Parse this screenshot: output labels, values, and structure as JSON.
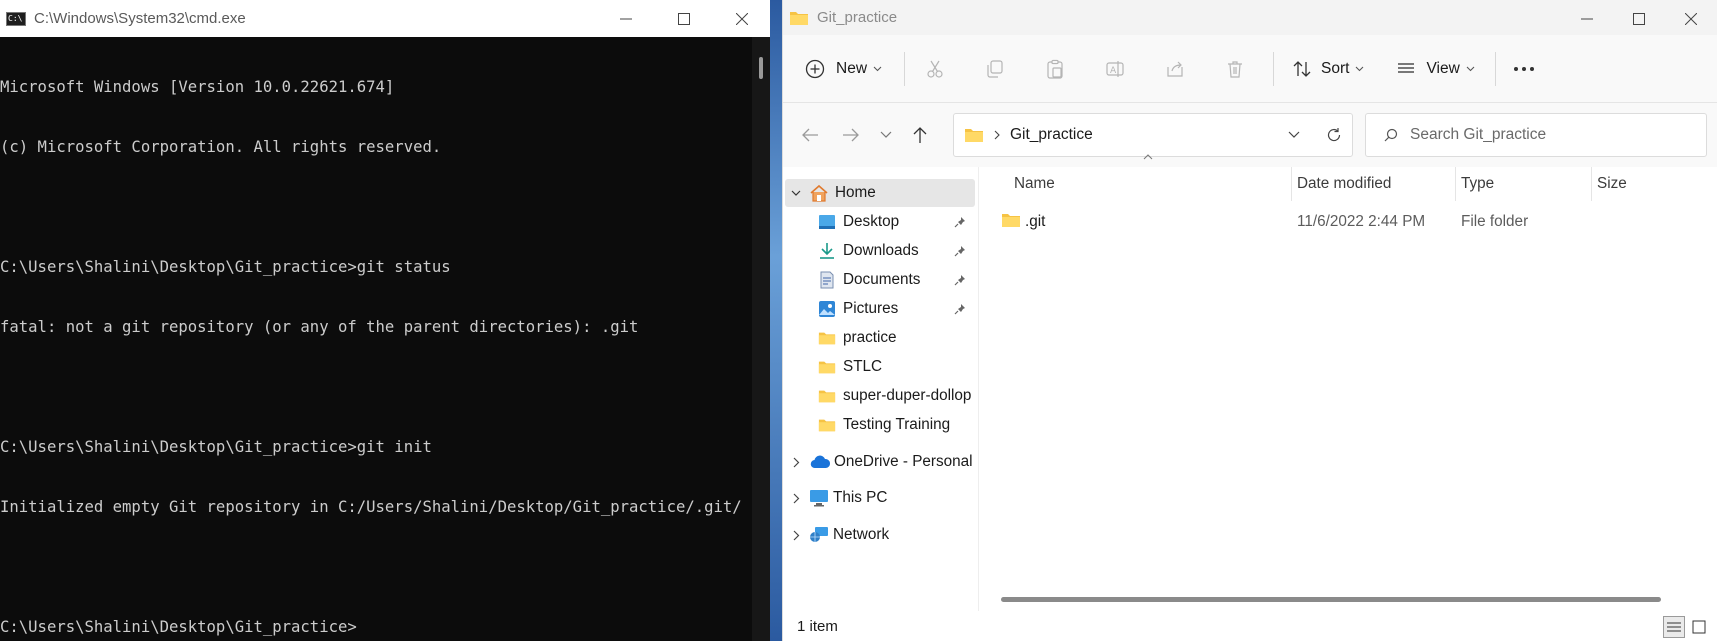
{
  "cmd": {
    "title": "C:\\Windows\\System32\\cmd.exe",
    "icon_text": "C:\\",
    "lines": [
      "Microsoft Windows [Version 10.0.22621.674]",
      "(c) Microsoft Corporation. All rights reserved.",
      "",
      "C:\\Users\\Shalini\\Desktop\\Git_practice>git status",
      "fatal: not a git repository (or any of the parent directories): .git",
      "",
      "C:\\Users\\Shalini\\Desktop\\Git_practice>git init",
      "Initialized empty Git repository in C:/Users/Shalini/Desktop/Git_practice/.git/",
      "",
      "C:\\Users\\Shalini\\Desktop\\Git_practice>"
    ]
  },
  "explorer": {
    "title": "Git_practice",
    "toolbar": {
      "new_label": "New",
      "sort_label": "Sort",
      "view_label": "View"
    },
    "address": {
      "crumb": "Git_practice"
    },
    "search": {
      "placeholder": "Search Git_practice"
    },
    "nav": {
      "home": "Home",
      "quick_access": [
        {
          "label": "Desktop",
          "icon": "desktop-icon",
          "pinned": true
        },
        {
          "label": "Downloads",
          "icon": "downloads-icon",
          "pinned": true
        },
        {
          "label": "Documents",
          "icon": "documents-icon",
          "pinned": true
        },
        {
          "label": "Pictures",
          "icon": "pictures-icon",
          "pinned": true
        },
        {
          "label": "practice",
          "icon": "folder-icon",
          "pinned": false
        },
        {
          "label": "STLC",
          "icon": "folder-icon",
          "pinned": false
        },
        {
          "label": "super-duper-dollop",
          "icon": "folder-icon",
          "pinned": false
        },
        {
          "label": "Testing Training",
          "icon": "folder-icon",
          "pinned": false
        }
      ],
      "onedrive": "OneDrive - Personal",
      "this_pc": "This PC",
      "network": "Network"
    },
    "columns": {
      "name": "Name",
      "date": "Date modified",
      "type": "Type",
      "size": "Size"
    },
    "files": [
      {
        "name": ".git",
        "date": "11/6/2022 2:44 PM",
        "type": "File folder",
        "size": ""
      }
    ],
    "status": {
      "count": "1 item"
    }
  },
  "colors": {
    "cmd_bg": "#0c0c0c",
    "cmd_text": "#cccccc",
    "folder": "#f6c344",
    "selected": "#e6e6e6"
  }
}
